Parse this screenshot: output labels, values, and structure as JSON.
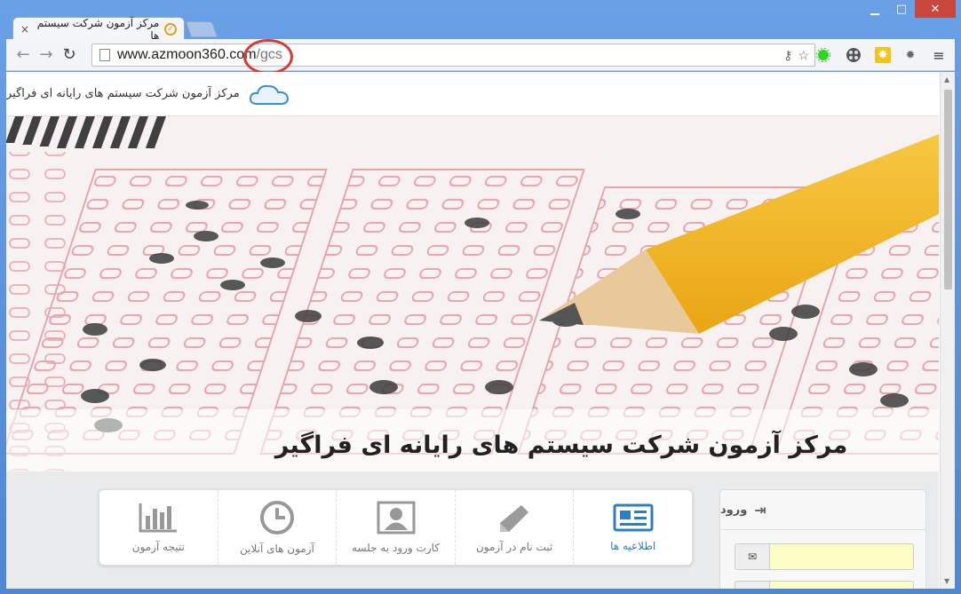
{
  "browser": {
    "tab_title": "مرکز آزمون شرکت سیستم ها",
    "tab_close": "×",
    "url_host": "www.azmoon360.com",
    "url_path": "/gcs",
    "window_controls": [
      "minimize-icon",
      "maximize-icon",
      "close-icon"
    ]
  },
  "site": {
    "header_title": "مرکز آزمون شرکت سیستم های رایانه ای فراگیر",
    "hero_caption": "مرکز آزمون شرکت سیستم های رایانه ای فراگیر"
  },
  "menu": {
    "items": [
      {
        "label": "اطلاعیه ها",
        "icon": "newspaper-icon",
        "active": true
      },
      {
        "label": "ثبت نام در آزمون",
        "icon": "pencil-icon",
        "active": false
      },
      {
        "label": "کارت ورود به جلسه",
        "icon": "id-card-icon",
        "active": false
      },
      {
        "label": "آزمون های آنلاین",
        "icon": "clock-icon",
        "active": false
      },
      {
        "label": "نتیجه آزمون",
        "icon": "bar-chart-icon",
        "active": false
      }
    ]
  },
  "login": {
    "title": "ورود",
    "icon": "sign-in-icon",
    "email_icon": "envelope-icon"
  },
  "colors": {
    "accent": "#2d7fc1",
    "frame": "#5b8fd6",
    "highlight_ring": "#d83c2f",
    "input_bg": "#fbfdc4"
  }
}
